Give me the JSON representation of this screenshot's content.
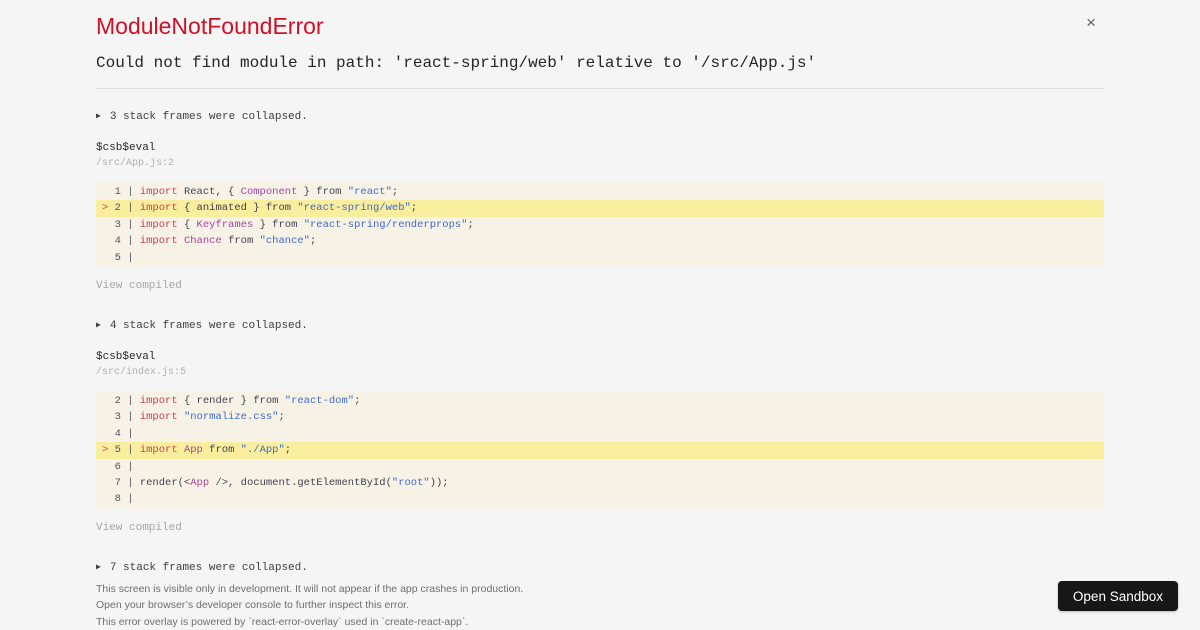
{
  "overlay": {
    "title": "ModuleNotFoundError",
    "message": "Could not find module in path: 'react-spring/web' relative to '/src/App.js'",
    "close_glyph": "×"
  },
  "collapse_icon": "▶",
  "highlight_marker": ">",
  "sections": [
    {
      "type": "collapsed",
      "text": "3 stack frames were collapsed."
    },
    {
      "type": "frame",
      "function": "$csb$eval",
      "location": "/src/App.js:2",
      "view_link": "View compiled",
      "lines": [
        {
          "n": "1",
          "hl": false,
          "tokens": [
            [
              "k",
              "import"
            ],
            [
              "p",
              " React, { "
            ],
            [
              "c",
              "Component"
            ],
            [
              "p",
              " } from "
            ],
            [
              "s",
              "\"react\""
            ],
            [
              "p",
              ";"
            ]
          ]
        },
        {
          "n": "2",
          "hl": true,
          "tokens": [
            [
              "k",
              "import"
            ],
            [
              "p",
              " { animated } from "
            ],
            [
              "s",
              "\"react-spring/web\""
            ],
            [
              "p",
              ";"
            ]
          ]
        },
        {
          "n": "3",
          "hl": false,
          "tokens": [
            [
              "k",
              "import"
            ],
            [
              "p",
              " { "
            ],
            [
              "c",
              "Keyframes"
            ],
            [
              "p",
              " } from "
            ],
            [
              "s",
              "\"react-spring/renderprops\""
            ],
            [
              "p",
              ";"
            ]
          ]
        },
        {
          "n": "4",
          "hl": false,
          "tokens": [
            [
              "k",
              "import"
            ],
            [
              "p",
              " "
            ],
            [
              "c",
              "Chance"
            ],
            [
              "p",
              " from "
            ],
            [
              "s",
              "\"chance\""
            ],
            [
              "p",
              ";"
            ]
          ]
        },
        {
          "n": "5",
          "hl": false,
          "tokens": []
        }
      ]
    },
    {
      "type": "collapsed",
      "text": "4 stack frames were collapsed."
    },
    {
      "type": "frame",
      "function": "$csb$eval",
      "location": "/src/index.js:5",
      "view_link": "View compiled",
      "lines": [
        {
          "n": "2",
          "hl": false,
          "tokens": [
            [
              "k",
              "import"
            ],
            [
              "p",
              " { render } from "
            ],
            [
              "s",
              "\"react-dom\""
            ],
            [
              "p",
              ";"
            ]
          ]
        },
        {
          "n": "3",
          "hl": false,
          "tokens": [
            [
              "k",
              "import"
            ],
            [
              "p",
              " "
            ],
            [
              "s",
              "\"normalize.css\""
            ],
            [
              "p",
              ";"
            ]
          ]
        },
        {
          "n": "4",
          "hl": false,
          "tokens": []
        },
        {
          "n": "5",
          "hl": true,
          "tokens": [
            [
              "k",
              "import"
            ],
            [
              "p",
              " "
            ],
            [
              "c",
              "App"
            ],
            [
              "p",
              " from "
            ],
            [
              "s",
              "\"./App\""
            ],
            [
              "p",
              ";"
            ]
          ]
        },
        {
          "n": "6",
          "hl": false,
          "tokens": []
        },
        {
          "n": "7",
          "hl": false,
          "tokens": [
            [
              "p",
              "render(<"
            ],
            [
              "c",
              "App"
            ],
            [
              "p",
              " />, document.getElementById("
            ],
            [
              "s",
              "\"root\""
            ],
            [
              "p",
              "));"
            ]
          ]
        },
        {
          "n": "8",
          "hl": false,
          "tokens": []
        }
      ]
    },
    {
      "type": "collapsed",
      "text": "7 stack frames were collapsed."
    }
  ],
  "footer": {
    "lines": [
      "This screen is visible only in development. It will not appear if the app crashes in production.",
      "Open your browser’s developer console to further inspect this error.",
      "This error overlay is powered by `react-error-overlay` used in `create-react-app`."
    ]
  },
  "sandbox_button": {
    "label": "Open Sandbox"
  },
  "theme": {
    "page_bg": "#f5f5f5",
    "title_color": "#ce1126",
    "code_bg": "#f6f3e6",
    "highlight_bg": "#f8ee9e",
    "keyword_color": "#d13e53",
    "class_color": "#a844a1",
    "string_color": "#4169c9",
    "plain_color": "#43414e",
    "button_bg": "#171717"
  }
}
